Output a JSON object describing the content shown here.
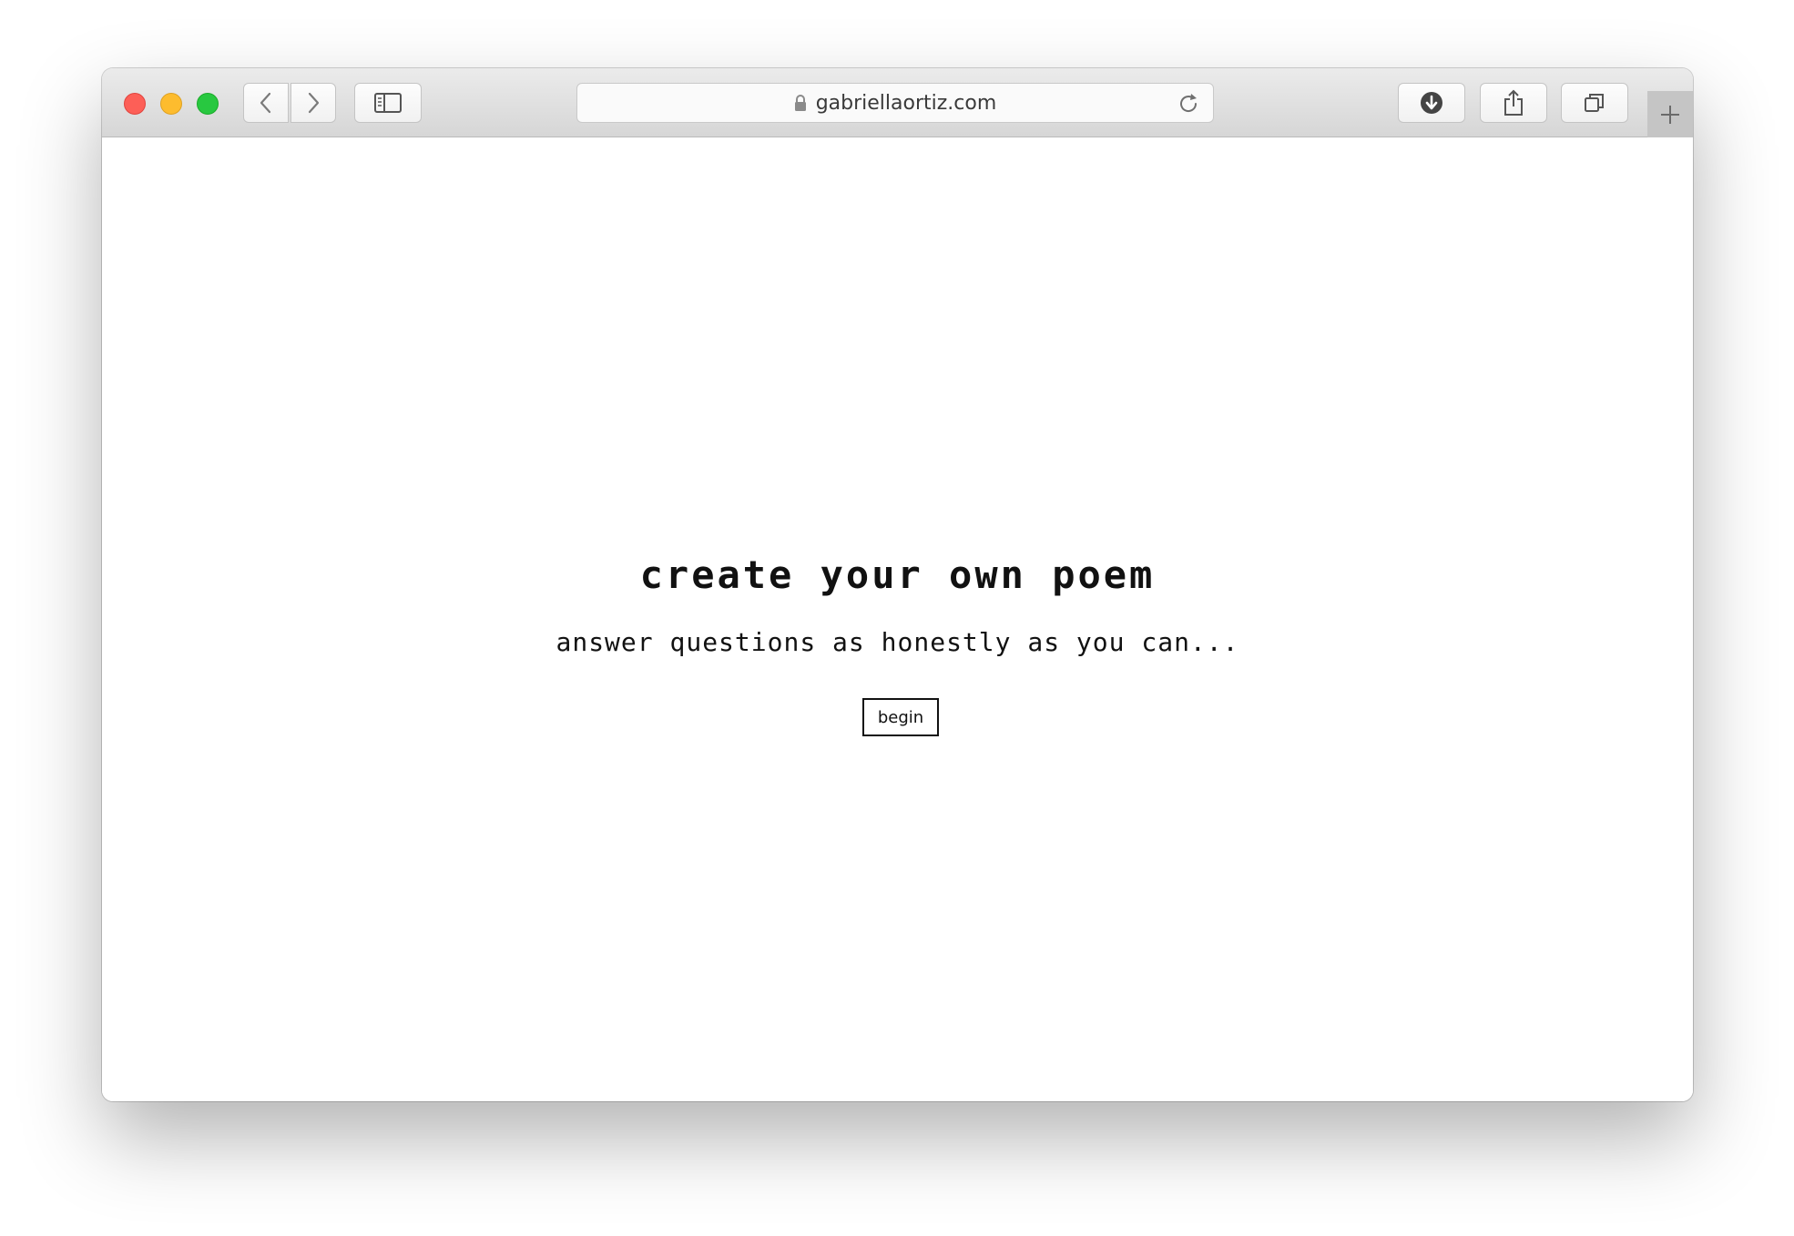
{
  "browser": {
    "url": "gabriellaortiz.com",
    "icons": {
      "back": "chevron-left-icon",
      "forward": "chevron-right-icon",
      "sidebar": "sidebar-icon",
      "lock": "lock-icon",
      "reload": "reload-icon",
      "download": "download-icon",
      "share": "share-icon",
      "tabs": "tabs-icon",
      "new_tab": "plus-icon"
    },
    "traffic_colors": {
      "close": "#fd5f57",
      "minimize": "#fdbc2e",
      "maximize": "#28c840"
    }
  },
  "page": {
    "title": "create your own poem",
    "subtitle": "answer questions as honestly as you can...",
    "begin_label": "begin"
  }
}
